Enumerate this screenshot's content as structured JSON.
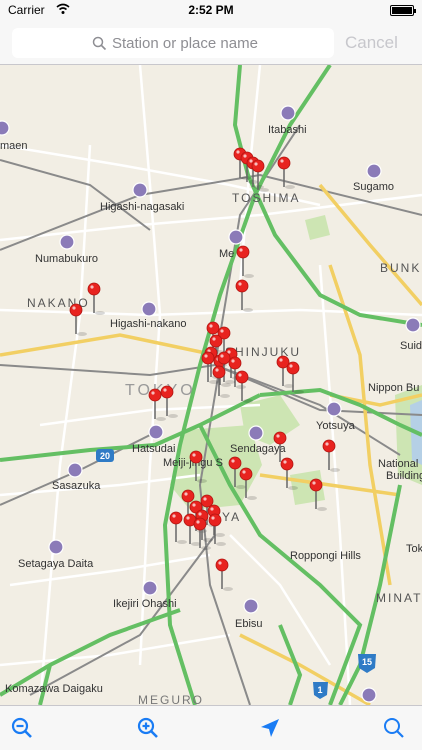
{
  "status": {
    "carrier": "Carrier",
    "time": "2:52 PM"
  },
  "search": {
    "placeholder": "Station or place name",
    "cancel": "Cancel"
  },
  "labels": {
    "itabashi": "Itabashi",
    "toshima": "TOSHIMA",
    "sugamo": "Sugamo",
    "higashi_nagasaki": "Higashi-nagasaki",
    "numabukuro": "Numabukuro",
    "bunkyo": "BUNK",
    "nakano": "NAKANO",
    "higashi_nakano": "Higashi-nakano",
    "shinjuku": "SHINJUKU",
    "tokyo": "TOKYO",
    "hatsudai": "Hatsudai",
    "sendagaya": "Sendagaya",
    "yotsuya": "Yotsuya",
    "sasazuka": "Sasazuka",
    "meiji_jingu": "Meiji-jingu S",
    "national_diet": "National Die",
    "building": "Building",
    "setagaya_daita": "Setagaya Daita",
    "roppongi_hills": "Roppongi Hills",
    "ikejiri_ohashi": "Ikejiri Ohashi",
    "ebisu": "Ebisu",
    "minato": "MINATO",
    "komazawa_daigaku": "Komazawa Daigaku",
    "meguro": "MEGURO",
    "nippon_bu": "Nippon Bu",
    "mejiro": "Me",
    "maen": "maen",
    "suido": "Suid",
    "ya": "YA",
    "tok": "Tok",
    "route_20": "20",
    "route_1": "1",
    "route_15": "15"
  },
  "colors": {
    "expressway": "#6cc36c",
    "arterial": "#f5d26b",
    "pin": "#e8231f",
    "park": "#c9e3b0",
    "accent": "#1a7cf4"
  },
  "toolbar": {
    "zoom_out_icon": "zoom-out-icon",
    "zoom_in_icon": "zoom-in-icon",
    "location_icon": "location-arrow-icon",
    "search_icon": "search-icon"
  }
}
